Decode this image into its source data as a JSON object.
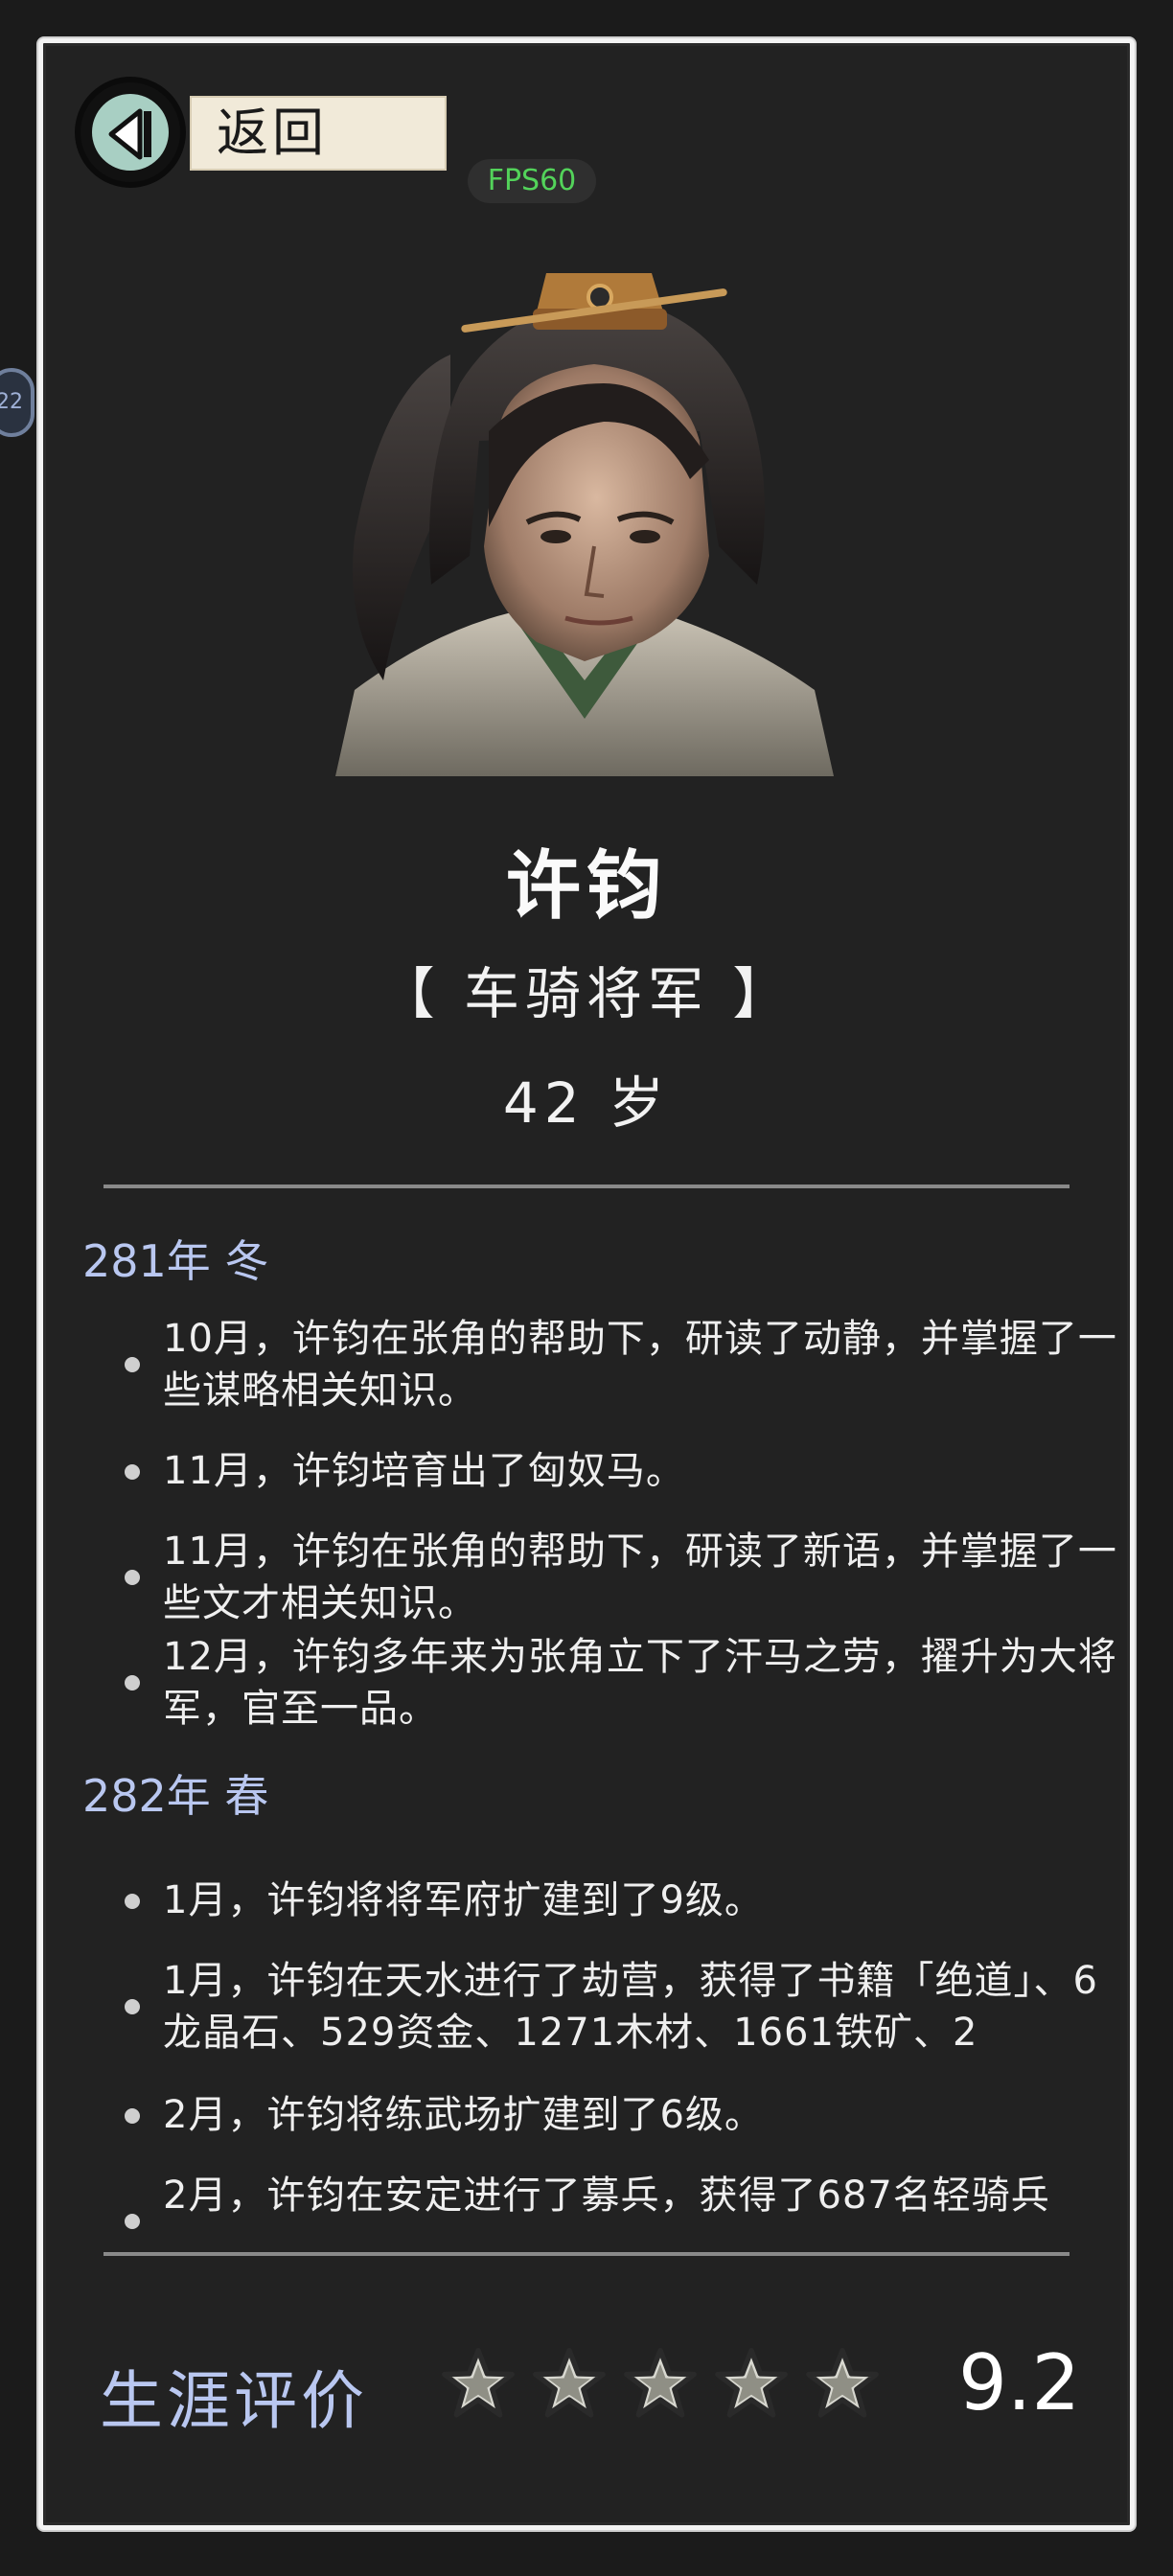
{
  "header": {
    "back_label": "返回",
    "fps_label": "FPS60",
    "side_badge": "22"
  },
  "character": {
    "name": "许钧",
    "title": "【 车骑将军 】",
    "age": "42 岁"
  },
  "timeline": [
    {
      "season": "281年 冬",
      "events": [
        "10月，许钧在张角的帮助下，研读了动静，并掌握了一些谋略相关知识。",
        "11月，许钧培育出了匈奴马。",
        "11月，许钧在张角的帮助下，研读了新语，并掌握了一些文才相关知识。",
        "12月，许钧多年来为张角立下了汗马之劳，擢升为大将军，官至一品。"
      ]
    },
    {
      "season": "282年 春",
      "events": [
        "1月，许钧将将军府扩建到了9级。",
        "1月，许钧在天水进行了劫营，获得了书籍「绝道」、6龙晶石、529资金、1271木材、1661铁矿、2",
        "2月，许钧将练武场扩建到了6级。",
        "2月，许钧在安定进行了募兵，获得了687名轻骑兵"
      ]
    }
  ],
  "rating": {
    "label": "生涯评价",
    "stars": 5,
    "score": "9.2"
  },
  "colors": {
    "background": "#1b1b1b",
    "panel": "#222222",
    "accent_blue": "#b9c7f0",
    "fps_green": "#53d35a",
    "back_paper": "#f1ead9",
    "back_circle": "#a8cfc3"
  }
}
